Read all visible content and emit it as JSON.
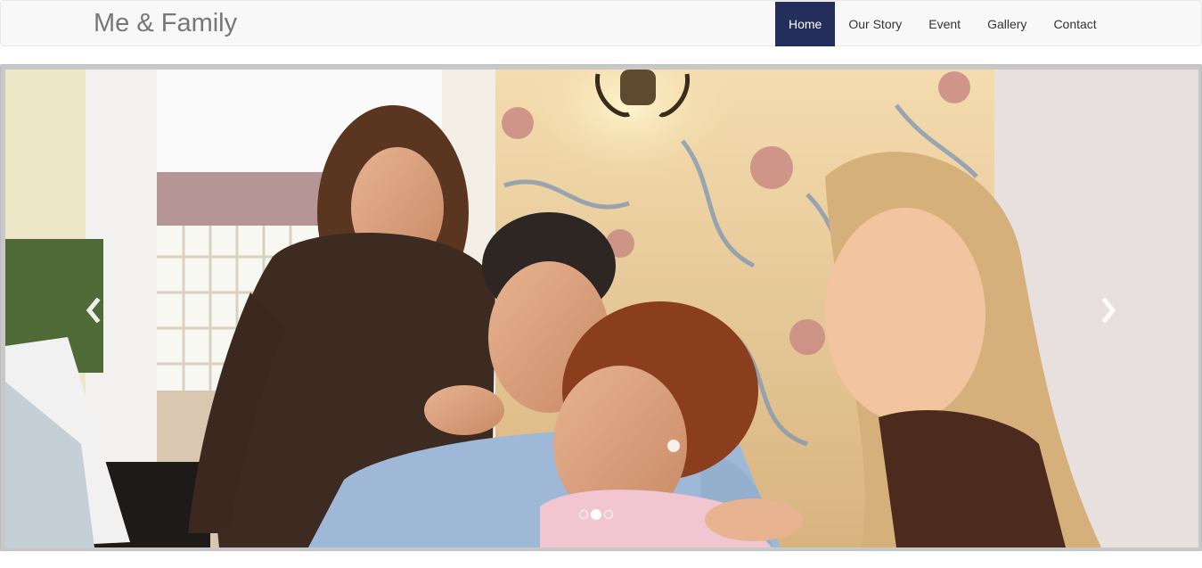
{
  "navbar": {
    "brand": "Me & Family",
    "items": [
      {
        "label": "Home",
        "active": true
      },
      {
        "label": "Our Story",
        "active": false
      },
      {
        "label": "Event",
        "active": false
      },
      {
        "label": "Gallery",
        "active": false
      },
      {
        "label": "Contact",
        "active": false
      }
    ]
  },
  "carousel": {
    "slides_total": 3,
    "active_slide": 2,
    "controls": {
      "prev_icon": "chevron-left-icon",
      "next_icon": "chevron-right-icon"
    }
  },
  "colors": {
    "navbar_bg": "#f8f8f8",
    "active_nav_bg": "#232e5b",
    "brand_text": "#777777"
  }
}
